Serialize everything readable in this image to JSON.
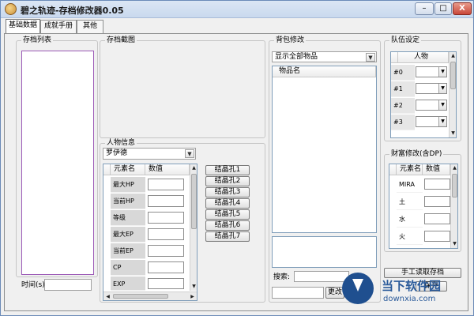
{
  "window": {
    "title": "碧之轨迹-存档修改器0.05",
    "btn_min": "–",
    "btn_max": "□",
    "btn_close": "X"
  },
  "tabs": [
    "基础数据",
    "成就手册",
    "其他"
  ],
  "save_list": {
    "label": "存档列表",
    "time_label": "时间(s):",
    "time_value": ""
  },
  "screenshot": {
    "label": "存档截图"
  },
  "character": {
    "label": "人物信息",
    "selected": "罗伊德",
    "col_name": "元素名",
    "col_value": "数值",
    "rows": [
      "最大HP",
      "当前HP",
      "等级",
      "最大EP",
      "当前EP",
      "CP",
      "EXP"
    ]
  },
  "slots": [
    "结晶孔1",
    "结晶孔2",
    "结晶孔3",
    "结晶孔4",
    "结晶孔5",
    "结晶孔6",
    "结晶孔7"
  ],
  "bag": {
    "label": "背包修改",
    "filter": "显示全部物品",
    "col_item": "物品名",
    "search_label": "搜索:",
    "change_btn": "更改"
  },
  "party": {
    "label": "队伍设定",
    "col": "人物",
    "rows": [
      "#0",
      "#1",
      "#2",
      "#3"
    ]
  },
  "wealth": {
    "label": "财富修改(含DP)",
    "col_name": "元素名",
    "col_value": "数值",
    "rows": [
      "MIRA",
      "土",
      "水",
      "火"
    ]
  },
  "manual_read_btn": "手工读取存档",
  "save_btn": "保存",
  "watermark": {
    "brand": "当下软件园",
    "domain": "downxia.com"
  },
  "icons": [
    "app-icon",
    "dropdown-arrow-icon",
    "scroll-up-icon",
    "scroll-down-icon",
    "scroll-left-icon",
    "scroll-right-icon",
    "download-arrow-icon"
  ]
}
